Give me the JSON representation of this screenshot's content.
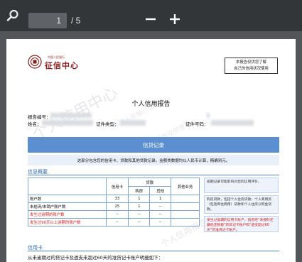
{
  "viewer": {
    "current_page": "1",
    "total_pages": "/ 5",
    "icons": {
      "search": "search-icon",
      "zoom_out": "minus-icon",
      "zoom_in": "plus-icon"
    }
  },
  "colors": {
    "toolbar_bg": "#323639",
    "viewer_bg": "#525659",
    "band_blue": "#5b8fcf",
    "section_blue": "#2f6db5",
    "red": "#d21e1e"
  },
  "header": {
    "logo_small": "中国人民银行",
    "logo_text": "征信中心",
    "stamp_line1": "本报告仅供您了解",
    "stamp_line2": "自己的信用状况使用"
  },
  "watermarks": [
    "个人信用中心",
    "中国人民银行征信中心",
    "个人信用报告仅供使用",
    "个人信用报告仅供使用"
  ],
  "title": "个人信用报告",
  "fields": {
    "report_no_label": "报告编号：",
    "name_label": "姓名：",
    "id_type_label": "证件类型：",
    "id_no_label": "证件号码："
  },
  "credit_record": {
    "band_title": "信贷记录",
    "band_note": "这部分包含您的信用卡、贷款和其他贷款记录。金额类数据均以人民币计算，精确到元。"
  },
  "summary": {
    "section_title": "信息概要",
    "headers": {
      "credit_card": "信用卡",
      "loans": "贷款",
      "housing": "购房",
      "other": "其他",
      "other_business": "其他业务"
    },
    "rows": [
      {
        "label": "账户数",
        "card": "33",
        "housing": "1",
        "other": "1",
        "other_business": "",
        "red": false
      },
      {
        "label": "未结清/未销户账户数",
        "card": "25",
        "housing": "1",
        "other": "--",
        "other_business": "",
        "red": false
      },
      {
        "label": "发生过逾期的账户数",
        "card": "--",
        "housing": "--",
        "other": "--",
        "other_business": "",
        "red": true
      },
      {
        "label": "发生过90天以上逾期的账户数",
        "card": "--",
        "housing": "--",
        "other": "--",
        "other_business": "",
        "red": true
      }
    ],
    "side_notes": [
      "逾期记录可能影响对您的信用评价。",
      "购房贷款，包括个人住房贷款、个人商用房（包括商住两用）贷款和个人住房公积金贷款。",
      "发生过逾期的信用卡账户，指曾经“未按时还最低还款额”的贷记卡账户和“透支超过60天”的准贷记卡账户。"
    ]
  },
  "credit_card_section": {
    "section_title": "信用卡",
    "intro": "从未逾期过的贷记卡及透支未超过60天的准贷记卡账户明细如下："
  }
}
